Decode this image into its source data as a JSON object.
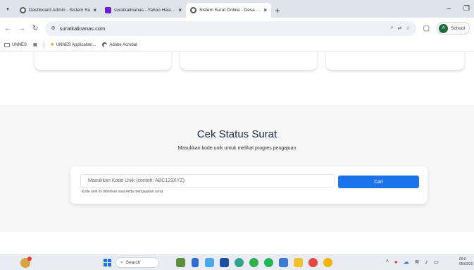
{
  "browser": {
    "tabs": [
      {
        "title": "Dashboard Admin - Sistem Su",
        "icon": "globe-icon",
        "active": false
      },
      {
        "title": "suratkalinanas - Yahoo Hasil Pe",
        "icon": "yahoo-icon",
        "active": false
      },
      {
        "title": "Sistem Surat Online - Desa Kal",
        "icon": "globe-icon",
        "active": true
      }
    ],
    "url": "suratkalinanas.com",
    "profile_initial": "A",
    "profile_label": "School",
    "bookmarks": [
      "UNNES",
      "UNNES Application...",
      "Adobe Acrobat"
    ]
  },
  "main": {
    "title": "Cek Status Surat",
    "subtitle": "Masukkan kode unik untuk melihat progres pengajuan",
    "input_placeholder": "Masukkan Kode Unik (contoh: ABC123XYZ)",
    "search_button": "Cari",
    "hint": "Kode unik ini diberikan saat Anda mengajukan surat"
  },
  "taskbar": {
    "search_label": "Search",
    "time": "00:0",
    "date": "05/03/20"
  },
  "colors": {
    "accent": "#1a73e8",
    "section_bg": "#f7f7f8",
    "title_text": "#1e2a3a"
  }
}
